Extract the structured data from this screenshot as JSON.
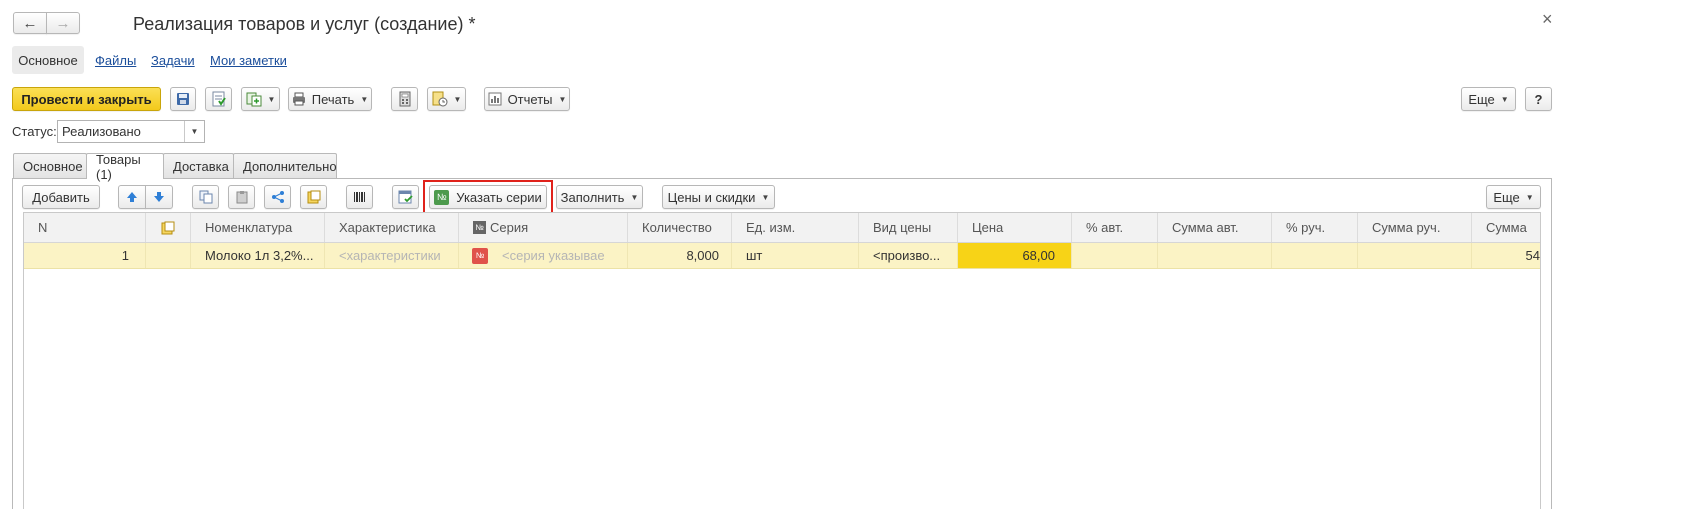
{
  "window": {
    "title": "Реализация товаров и услуг (создание) *",
    "close": "×"
  },
  "nav": {
    "back": "←",
    "forward": "→"
  },
  "section_links": [
    {
      "label": "Основное",
      "active": true
    },
    {
      "label": "Файлы"
    },
    {
      "label": "Задачи"
    },
    {
      "label": "Мои заметки"
    }
  ],
  "toolbar": {
    "post_close": "Провести и закрыть",
    "print": "Печать",
    "reports": "Отчеты",
    "more": "Еще",
    "help": "?"
  },
  "status": {
    "label": "Статус:",
    "value": "Реализовано"
  },
  "tabs": [
    {
      "label": "Основное"
    },
    {
      "label": "Товары (1)",
      "active": true
    },
    {
      "label": "Доставка"
    },
    {
      "label": "Дополнительно"
    }
  ],
  "items_toolbar": {
    "add": "Добавить",
    "specify_series": "Указать серии",
    "fill": "Заполнить",
    "prices_discounts": "Цены и скидки",
    "more": "Еще"
  },
  "table": {
    "columns": [
      "N",
      "",
      "Номенклатура",
      "Характеристика",
      "Серия",
      "Количество",
      "Ед. изм.",
      "Вид цены",
      "Цена",
      "% авт.",
      "Сумма авт.",
      "% руч.",
      "Сумма руч.",
      "Сумма"
    ],
    "rows": [
      {
        "n": "1",
        "nomenclature": "Молоко 1л 3,2%...",
        "characteristic": "<характеристики",
        "series": "<серия указывае",
        "quantity": "8,000",
        "unit": "шт",
        "price_type": "<произво...",
        "price": "68,00",
        "sum_partial": "54"
      }
    ]
  },
  "colors": {
    "primary_button": "#f3c91b",
    "highlight_row": "#fbf3c5",
    "price_cell": "#f7d317",
    "focus_outline": "#e0221b",
    "link": "#1b4e9b"
  }
}
